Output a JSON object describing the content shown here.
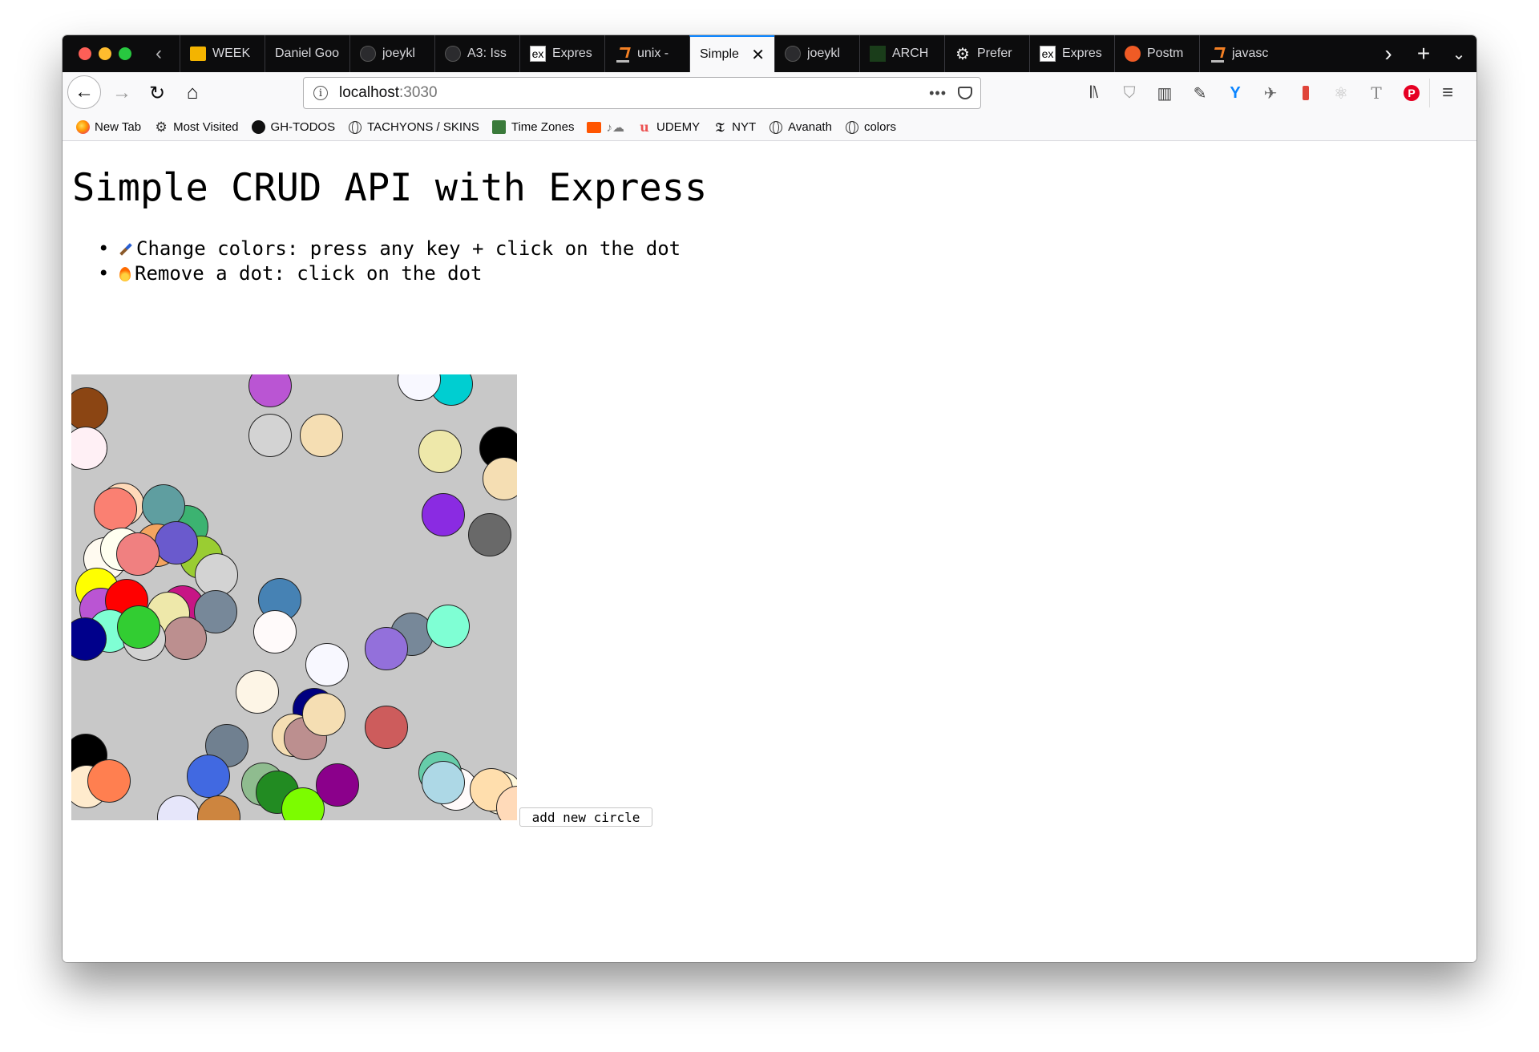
{
  "browser": {
    "tabs": [
      {
        "label": "WEEK",
        "icon": "slides-icon"
      },
      {
        "label": "Daniel Goo",
        "icon": ""
      },
      {
        "label": "joeykl",
        "icon": "github-icon"
      },
      {
        "label": "A3: Iss",
        "icon": "github-icon"
      },
      {
        "label": "Expres",
        "icon": "express-icon"
      },
      {
        "label": "unix -",
        "icon": "stackoverflow-icon"
      },
      {
        "label": "Simple",
        "icon": "",
        "active": true
      },
      {
        "label": "joeykl",
        "icon": "github-icon"
      },
      {
        "label": "ARCH",
        "icon": "arch-icon"
      },
      {
        "label": "Prefer",
        "icon": "gear-icon"
      },
      {
        "label": "Expres",
        "icon": "express-icon"
      },
      {
        "label": "Postm",
        "icon": "postman-icon"
      },
      {
        "label": "javasc",
        "icon": "stackoverflow-icon"
      }
    ],
    "url": {
      "host": "localhost",
      "port": ":3030"
    },
    "bookmarks": [
      {
        "label": "New Tab",
        "icon": "firefox-icon"
      },
      {
        "label": "Most Visited",
        "icon": "gear-icon"
      },
      {
        "label": "GH-TODOS",
        "icon": "github-icon"
      },
      {
        "label": "TACHYONS / SKINS",
        "icon": "globe-icon"
      },
      {
        "label": "Time Zones",
        "icon": "timezones-icon"
      },
      {
        "label": "♪☁",
        "icon": "soundcloud-icon"
      },
      {
        "label": "UDEMY",
        "icon": "udemy-icon"
      },
      {
        "label": "NYT",
        "icon": "nyt-icon"
      },
      {
        "label": "Avanath",
        "icon": "globe-icon"
      },
      {
        "label": "colors",
        "icon": "globe-icon"
      }
    ]
  },
  "page": {
    "title": "Simple CRUD API with Express",
    "instructions": [
      {
        "icon": "paintbrush-icon",
        "text": "Change colors: press any key + click on the dot"
      },
      {
        "icon": "fire-icon",
        "text": "Remove a dot: click on the dot"
      }
    ],
    "add_button_label": "add new circle"
  },
  "dots": [
    {
      "color": "#8b4513"
    },
    {
      "color": "#fff0f5"
    },
    {
      "color": "#ba55d3"
    },
    {
      "color": "#d3d3d3"
    },
    {
      "color": "#f5deb3"
    },
    {
      "color": "#00ced1"
    },
    {
      "color": "#f8f8ff"
    },
    {
      "color": "#eee8aa"
    },
    {
      "color": "#000000"
    },
    {
      "color": "#f5deb3"
    },
    {
      "color": "#8a2be2"
    },
    {
      "color": "#696969"
    },
    {
      "color": "#ffdab9"
    },
    {
      "color": "#fa8072"
    },
    {
      "color": "#3cb371"
    },
    {
      "color": "#5f9ea0"
    },
    {
      "color": "#f4a460"
    },
    {
      "color": "#fffaf0"
    },
    {
      "color": "#fffff0"
    },
    {
      "color": "#9acd32"
    },
    {
      "color": "#6a5acd"
    },
    {
      "color": "#f08080"
    },
    {
      "color": "#d3d3d3"
    },
    {
      "color": "#ffff00"
    },
    {
      "color": "#ba55d3"
    },
    {
      "color": "#ff0000"
    },
    {
      "color": "#c71585"
    },
    {
      "color": "#778899"
    },
    {
      "color": "#eee8aa"
    },
    {
      "color": "#7fffd4"
    },
    {
      "color": "#bc8f8f"
    },
    {
      "color": "#d3d3d3"
    },
    {
      "color": "#32cd32"
    },
    {
      "color": "#00008b"
    },
    {
      "color": "#4682b4"
    },
    {
      "color": "#fffafa"
    },
    {
      "color": "#778899"
    },
    {
      "color": "#9370db"
    },
    {
      "color": "#7fffd4"
    },
    {
      "color": "#f8f8ff"
    },
    {
      "color": "#fdf5e6"
    },
    {
      "color": "#000080"
    },
    {
      "color": "#f5deb3"
    },
    {
      "color": "#bc8f8f"
    },
    {
      "color": "#f5deb3"
    },
    {
      "color": "#cd5c5c"
    },
    {
      "color": "#000000"
    },
    {
      "color": "#ffebcd"
    },
    {
      "color": "#ff7f50"
    },
    {
      "color": "#708090"
    },
    {
      "color": "#4169e1"
    },
    {
      "color": "#e6e6fa"
    },
    {
      "color": "#cd853f"
    },
    {
      "color": "#8fbc8f"
    },
    {
      "color": "#228b22"
    },
    {
      "color": "#7cfc00"
    },
    {
      "color": "#8b008b"
    },
    {
      "color": "#fffafa"
    },
    {
      "color": "#66cdaa"
    },
    {
      "color": "#add8e6"
    },
    {
      "color": "#fff8dc"
    },
    {
      "color": "#ffdead"
    },
    {
      "color": "#ffdab9"
    }
  ]
}
